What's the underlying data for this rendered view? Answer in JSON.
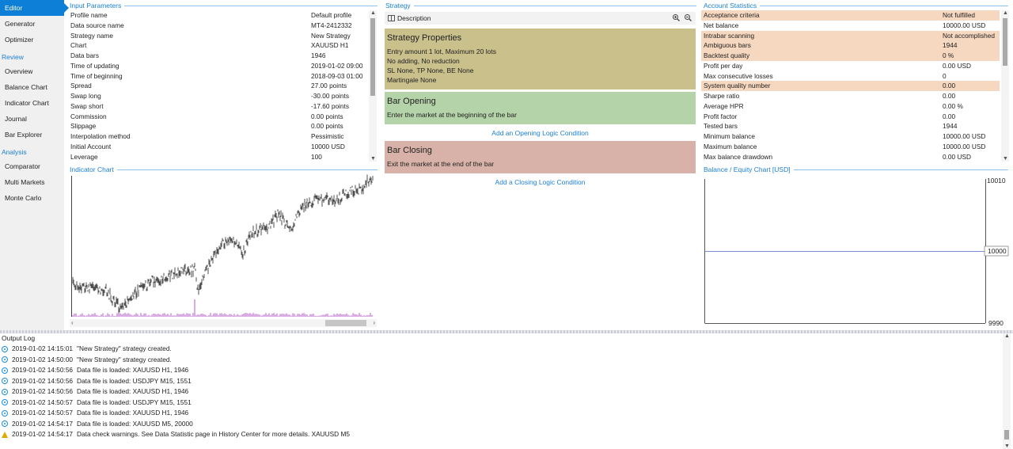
{
  "nav": {
    "items_top": [
      "Editor",
      "Generator",
      "Optimizer"
    ],
    "review_label": "Review",
    "items_review": [
      "Overview",
      "Balance Chart",
      "Indicator Chart",
      "Journal",
      "Bar Explorer"
    ],
    "analysis_label": "Analysis",
    "items_analysis": [
      "Comparator",
      "Multi Markets",
      "Monte Carlo"
    ]
  },
  "input_params": {
    "title": "Input Parameters",
    "rows": [
      {
        "k": "Profile name",
        "v": "Default profile"
      },
      {
        "k": "Data source name",
        "v": "MT4-2412332"
      },
      {
        "k": "Strategy name",
        "v": "New Strategy"
      },
      {
        "k": "Chart",
        "v": "XAUUSD H1"
      },
      {
        "k": "Data bars",
        "v": "1946"
      },
      {
        "k": "Time of updating",
        "v": "2019-01-02 09:00"
      },
      {
        "k": "Time of beginning",
        "v": "2018-09-03 01:00"
      },
      {
        "k": "Spread",
        "v": "27.00 points"
      },
      {
        "k": "Swap long",
        "v": "-30.00 points"
      },
      {
        "k": "Swap short",
        "v": "-17.60 points"
      },
      {
        "k": "Commission",
        "v": "0.00 points"
      },
      {
        "k": "Slippage",
        "v": "0.00 points"
      },
      {
        "k": "Interpolation method",
        "v": "Pessimistic"
      },
      {
        "k": "Initial Account",
        "v": "10000 USD"
      },
      {
        "k": "Leverage",
        "v": "100"
      }
    ]
  },
  "indicator_chart": {
    "title": "Indicator Chart"
  },
  "strategy": {
    "title": "Strategy",
    "description_label": "Description",
    "properties": {
      "heading": "Strategy Properties",
      "lines": [
        "Entry amount 1 lot, Maximum 20 lots",
        "No adding, No reduction",
        "SL None,  TP None,  BE None",
        "Martingale None"
      ]
    },
    "opening": {
      "heading": "Bar Opening",
      "line": "Enter the market at the beginning of the bar"
    },
    "add_opening": "Add an Opening Logic Condition",
    "closing": {
      "heading": "Bar Closing",
      "line": "Exit the market at the end of the bar"
    },
    "add_closing": "Add a Closing Logic Condition",
    "colors": {
      "properties": "#c9c08c",
      "opening": "#b4d3a8",
      "closing": "#d8b2a8"
    }
  },
  "account_stats": {
    "title": "Account Statistics",
    "rows": [
      {
        "k": "Acceptance criteria",
        "v": "Not fulfilled",
        "warn": true
      },
      {
        "k": "Net balance",
        "v": "10000.00 USD",
        "warn": false
      },
      {
        "k": "Intrabar scanning",
        "v": "Not accomplished",
        "warn": true
      },
      {
        "k": "Ambiguous bars",
        "v": "1944",
        "warn": true
      },
      {
        "k": "Backtest quality",
        "v": "0 %",
        "warn": true
      },
      {
        "k": "Profit per day",
        "v": "0.00 USD",
        "warn": false
      },
      {
        "k": "Max consecutive losses",
        "v": "0",
        "warn": false
      },
      {
        "k": "System quality number",
        "v": "0.00",
        "warn": true
      },
      {
        "k": "Sharpe ratio",
        "v": "0.00",
        "warn": false
      },
      {
        "k": "Average HPR",
        "v": "0.00 %",
        "warn": false
      },
      {
        "k": "Profit factor",
        "v": "0.00",
        "warn": false
      },
      {
        "k": "Tested bars",
        "v": "1944",
        "warn": false
      },
      {
        "k": "Minimum balance",
        "v": "10000.00 USD",
        "warn": false
      },
      {
        "k": "Maximum balance",
        "v": "10000.00 USD",
        "warn": false
      },
      {
        "k": "Max balance drawdown",
        "v": "0.00 USD",
        "warn": false
      }
    ]
  },
  "balance_chart": {
    "title": "Balance / Equity Chart [USD]",
    "y_top": "10010",
    "y_mid": "10000",
    "y_bottom": "9990"
  },
  "output_log": {
    "title": "Output Log",
    "rows": [
      {
        "type": "info",
        "ts": "2019-01-02 14:15:01",
        "msg": "\"New Strategy\" strategy created."
      },
      {
        "type": "info",
        "ts": "2019-01-02 14:50:00",
        "msg": "\"New Strategy\" strategy created."
      },
      {
        "type": "info",
        "ts": "2019-01-02 14:50:56",
        "msg": "Data file is loaded: XAUUSD H1, 1946"
      },
      {
        "type": "info",
        "ts": "2019-01-02 14:50:56",
        "msg": "Data file is loaded: USDJPY M15, 1551"
      },
      {
        "type": "info",
        "ts": "2019-01-02 14:50:56",
        "msg": "Data file is loaded: XAUUSD H1, 1946"
      },
      {
        "type": "info",
        "ts": "2019-01-02 14:50:57",
        "msg": "Data file is loaded: USDJPY M15, 1551"
      },
      {
        "type": "info",
        "ts": "2019-01-02 14:50:57",
        "msg": "Data file is loaded: XAUUSD H1, 1946"
      },
      {
        "type": "info",
        "ts": "2019-01-02 14:54:17",
        "msg": "Data file is loaded: XAUUSD M5, 20000"
      },
      {
        "type": "warn",
        "ts": "2019-01-02 14:54:17",
        "msg": "Data check warnings. See Data Statistic page in History Center for more details. XAUUSD M5"
      }
    ]
  }
}
